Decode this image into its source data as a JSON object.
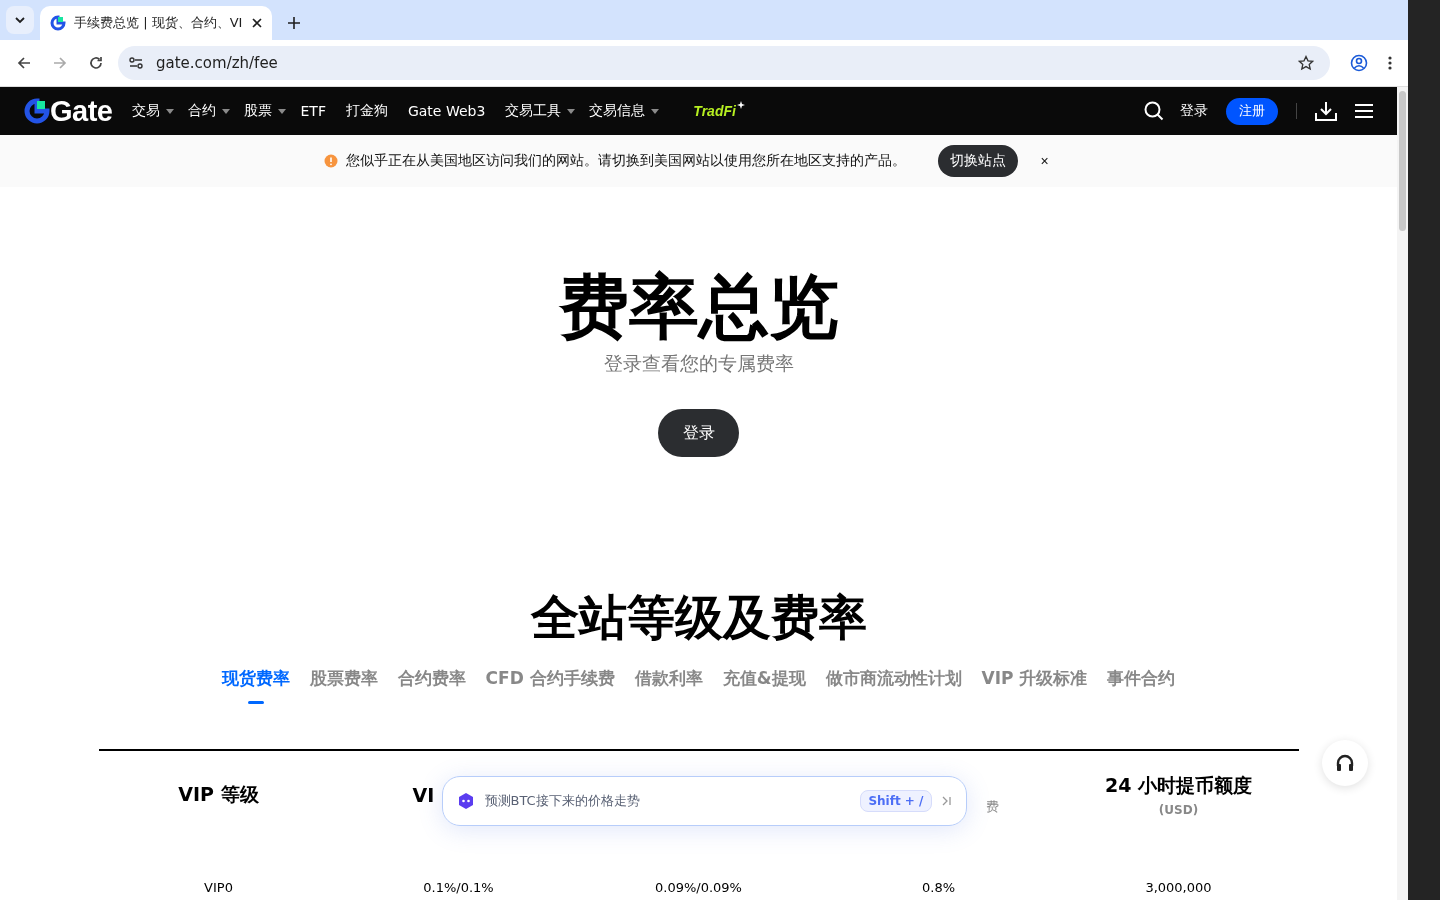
{
  "browser": {
    "tab_title": "手续费总览 | 现货、合约、VI",
    "url": "gate.com/zh/fee"
  },
  "nav": {
    "logo": "Gate",
    "items": [
      {
        "label": "交易",
        "dropdown": true
      },
      {
        "label": "合约",
        "dropdown": true
      },
      {
        "label": "股票",
        "dropdown": true
      },
      {
        "label": "ETF",
        "dropdown": false
      },
      {
        "label": "打金狗",
        "dropdown": false
      },
      {
        "label": "Gate Web3",
        "dropdown": false
      },
      {
        "label": "交易工具",
        "dropdown": true
      },
      {
        "label": "交易信息",
        "dropdown": true
      }
    ],
    "tradfi": "TradFi",
    "login": "登录",
    "register": "注册"
  },
  "banner": {
    "message": "您似乎正在从美国地区访问我们的网站。请切换到美国网站以使用您所在地区支持的产品。",
    "button": "切换站点",
    "close": "×"
  },
  "hero": {
    "title": "费率总览",
    "subtitle": "登录查看您的专属费率",
    "login_button": "登录"
  },
  "section": {
    "title": "全站等级及费率",
    "tabs": [
      {
        "label": "现货费率",
        "selected": true
      },
      {
        "label": "股票费率",
        "selected": false
      },
      {
        "label": "合约费率",
        "selected": false
      },
      {
        "label": "CFD 合约手续费",
        "selected": false
      },
      {
        "label": "借款利率",
        "selected": false
      },
      {
        "label": "充值&提现",
        "selected": false
      },
      {
        "label": "做市商流动性计划",
        "selected": false
      },
      {
        "label": "VIP 升级标准",
        "selected": false
      },
      {
        "label": "事件合约",
        "selected": false
      }
    ]
  },
  "table": {
    "columns": [
      {
        "label": "VIP 等级"
      },
      {
        "label": "VI"
      },
      {},
      {
        "sublabel": "费"
      },
      {
        "label": "24 小时提币额度",
        "sublabel": "(USD)"
      }
    ],
    "rows": [
      [
        "VIP0",
        "0.1%/0.1%",
        "0.09%/0.09%",
        "0.8%",
        "3,000,000"
      ]
    ]
  },
  "popup": {
    "text": "预测BTC接下来的价格走势",
    "shortcut": "Shift + /"
  }
}
